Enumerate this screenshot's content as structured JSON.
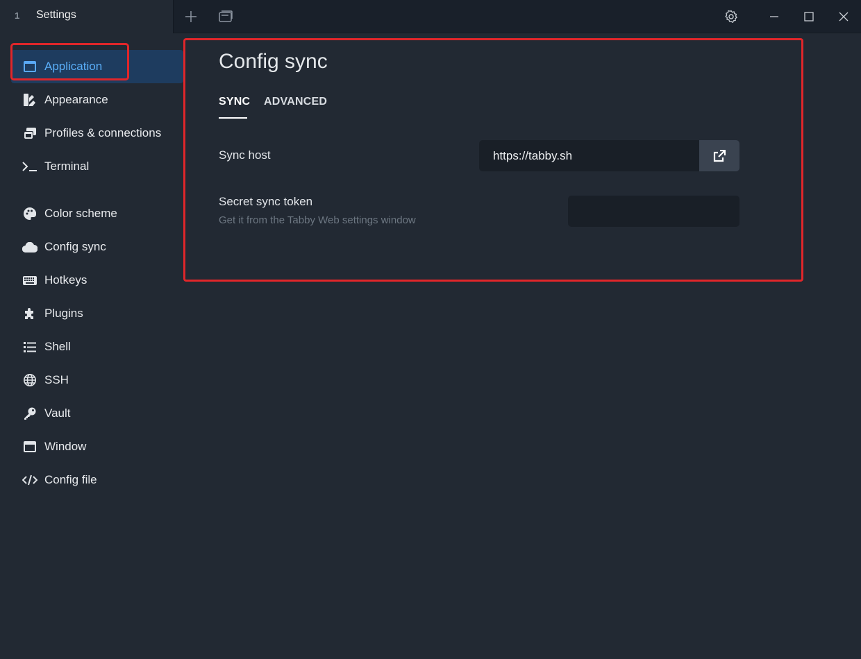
{
  "titlebar": {
    "tab_index": "1",
    "tab_title": "Settings",
    "buttons": [
      "plus-icon",
      "window-icon",
      "gear-icon",
      "minimize-icon",
      "maximize-icon",
      "close-icon"
    ]
  },
  "sidebar": {
    "items": [
      {
        "label": "Application",
        "icon": "application-icon",
        "active": true
      },
      {
        "label": "Appearance",
        "icon": "appearance-icon"
      },
      {
        "label": "Profiles & connections",
        "icon": "profiles-icon"
      },
      {
        "label": "Terminal",
        "icon": "terminal-icon"
      },
      {
        "label": "Color scheme",
        "icon": "palette-icon"
      },
      {
        "label": "Config sync",
        "icon": "cloud-icon"
      },
      {
        "label": "Hotkeys",
        "icon": "keyboard-icon"
      },
      {
        "label": "Plugins",
        "icon": "puzzle-icon"
      },
      {
        "label": "Shell",
        "icon": "list-icon"
      },
      {
        "label": "SSH",
        "icon": "globe-icon"
      },
      {
        "label": "Vault",
        "icon": "key-icon"
      },
      {
        "label": "Window",
        "icon": "window-icon"
      },
      {
        "label": "Config file",
        "icon": "code-icon"
      }
    ]
  },
  "main": {
    "title": "Config sync",
    "tabs": [
      {
        "label": "SYNC",
        "active": true
      },
      {
        "label": "ADVANCED"
      }
    ],
    "sync_host": {
      "label": "Sync host",
      "value": "https://tabby.sh"
    },
    "secret_token": {
      "label": "Secret sync token",
      "description": "Get it from the Tabby Web settings window",
      "value": ""
    }
  },
  "colors": {
    "background": "#222933",
    "accent": "#5aaef8",
    "highlight": "#e0262a"
  }
}
